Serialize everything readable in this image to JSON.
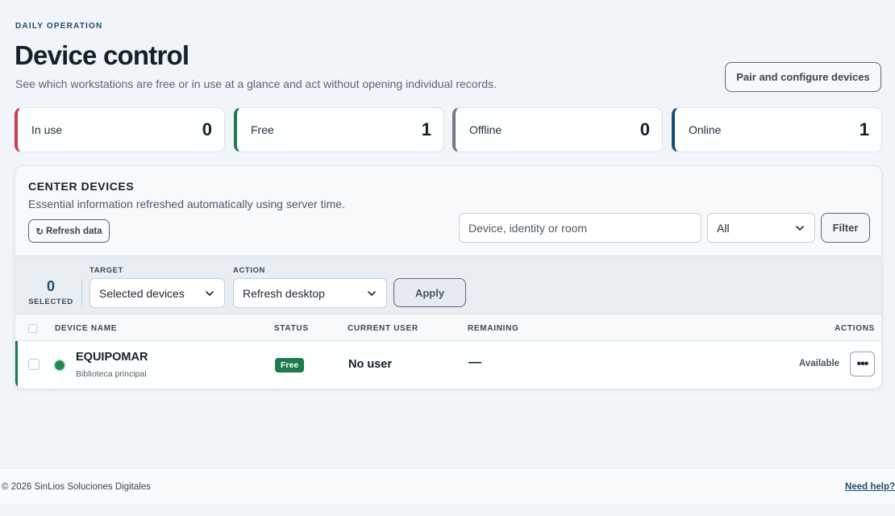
{
  "header": {
    "eyebrow": "DAILY OPERATION",
    "title": "Device control",
    "subtitle": "See which workstations are free or in use at a glance and act without opening individual records.",
    "pair_button": "Pair and configure devices"
  },
  "stats": [
    {
      "label": "In use",
      "value": "0",
      "color": "#c8404c"
    },
    {
      "label": "Free",
      "value": "1",
      "color": "#1f7a4d"
    },
    {
      "label": "Offline",
      "value": "0",
      "color": "#6d7a86"
    },
    {
      "label": "Online",
      "value": "1",
      "color": "#1f4e6e"
    }
  ],
  "panel": {
    "title": "CENTER DEVICES",
    "description": "Essential information refreshed automatically using server time.",
    "refresh_icon": "↻",
    "refresh_label": "Refresh data",
    "search_placeholder": "Device, identity or room",
    "status_filter_value": "All",
    "filter_button": "Filter"
  },
  "bulk": {
    "selected_count": "0",
    "selected_label": "SELECTED",
    "target_label": "TARGET",
    "target_value": "Selected devices",
    "action_label": "ACTION",
    "action_value": "Refresh desktop",
    "apply_button": "Apply"
  },
  "table": {
    "columns": {
      "device_name": "DEVICE NAME",
      "status": "STATUS",
      "current_user": "CURRENT USER",
      "remaining": "REMAINING",
      "actions": "ACTIONS"
    },
    "rows": [
      {
        "name": "EQUIPOMAR",
        "room": "Biblioteca principal",
        "status": "Free",
        "current_user": "No user",
        "remaining": "—",
        "availability": "Available",
        "more_icon": "•••"
      }
    ]
  },
  "footer": {
    "copyright": "© 2026 SinLios Soluciones Digitales",
    "help_link": "Need help?"
  }
}
